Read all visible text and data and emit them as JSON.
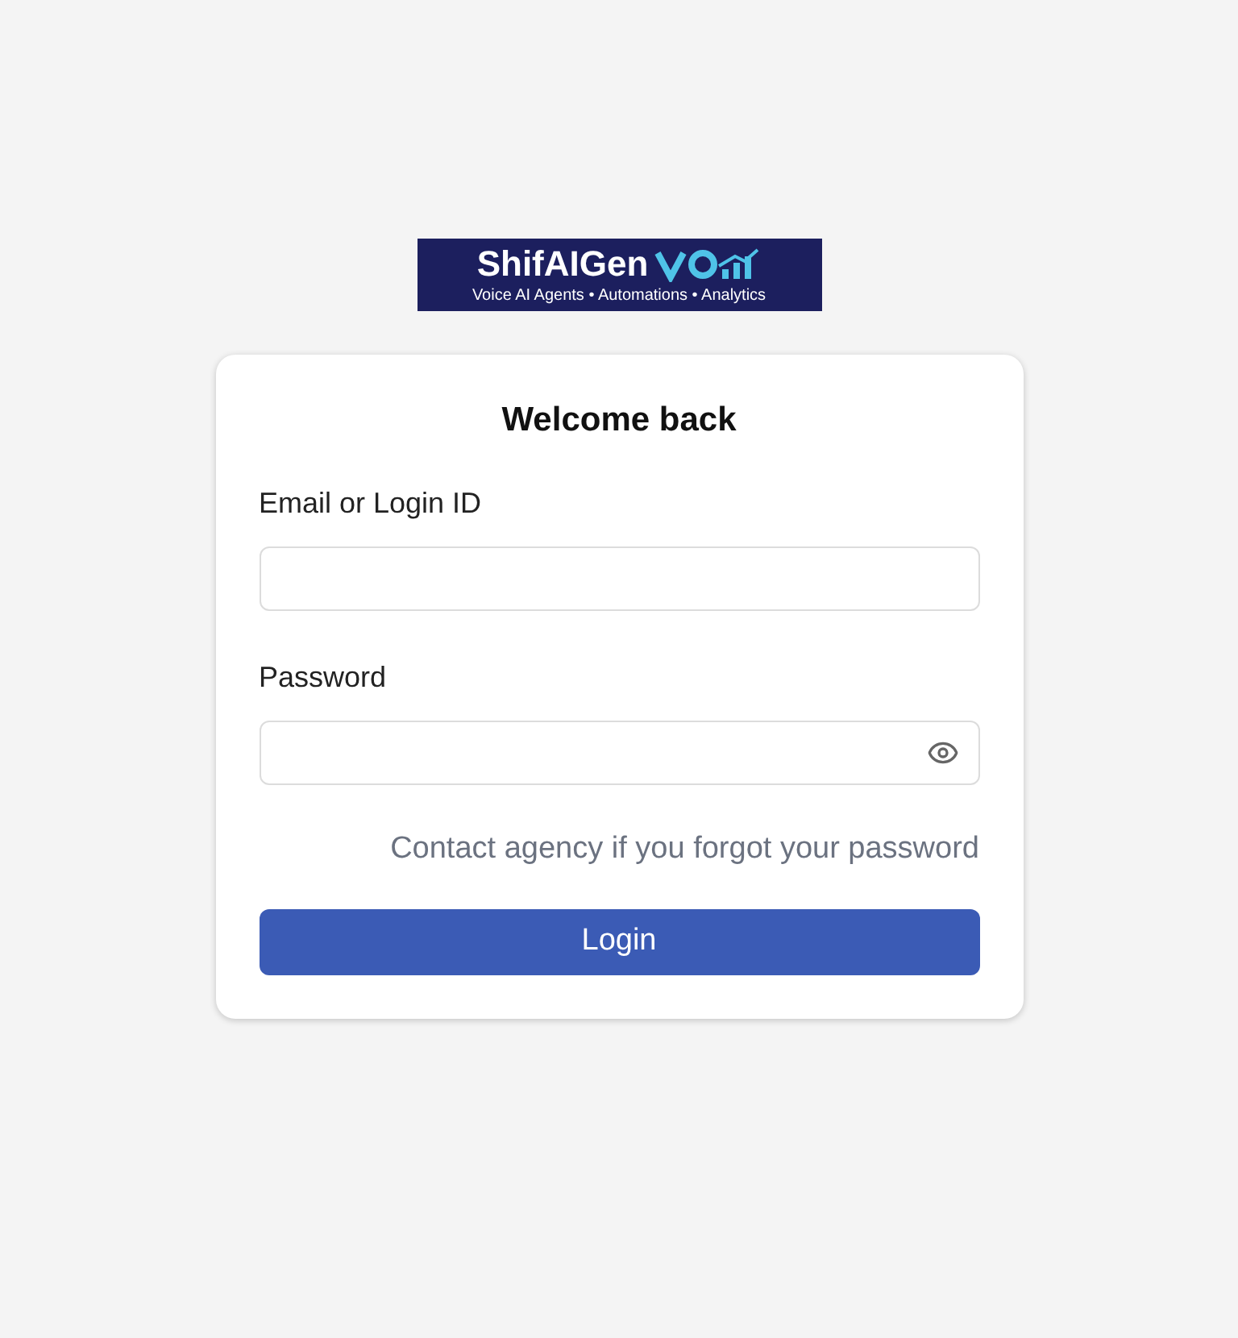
{
  "logo": {
    "name": "ShifAIGen",
    "tagline": "Voice AI Agents • Automations • Analytics"
  },
  "card": {
    "title": "Welcome back",
    "fields": [
      {
        "label": "Email or Login ID",
        "kind": "text"
      },
      {
        "label": "Password",
        "kind": "password"
      }
    ],
    "help_text": "Contact agency if you forgot your password",
    "button": "Login"
  }
}
